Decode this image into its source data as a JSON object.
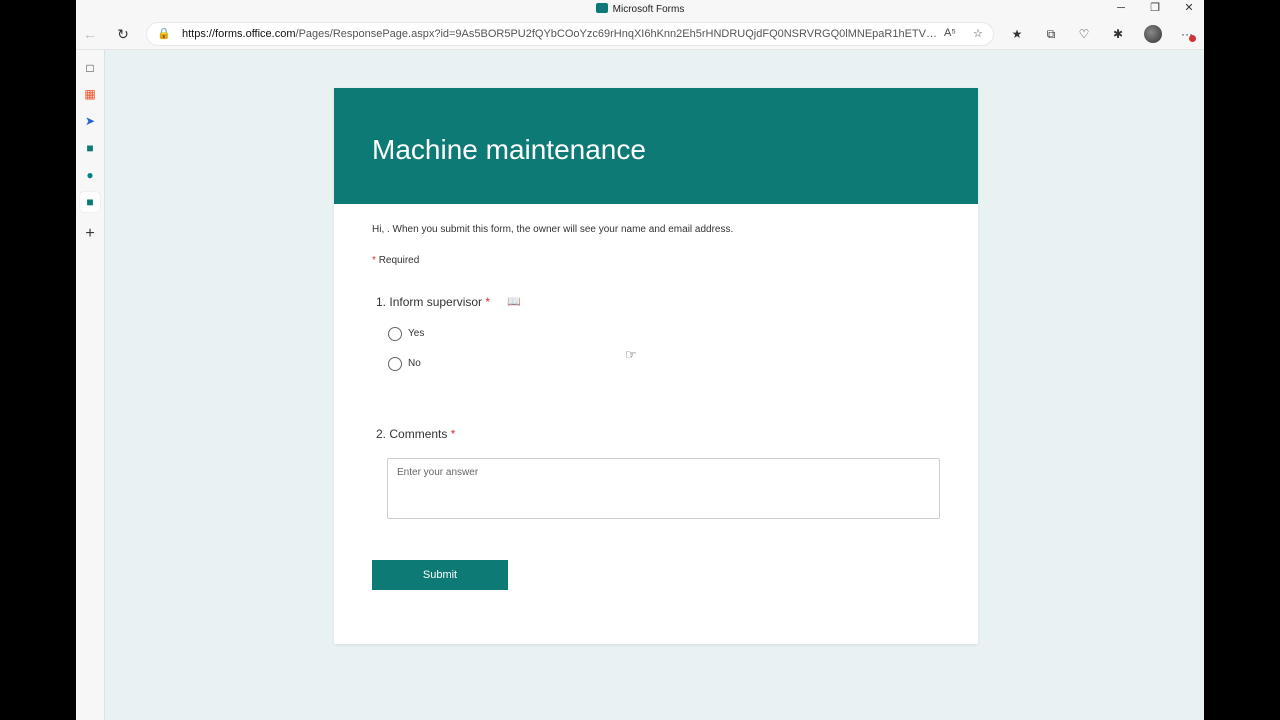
{
  "browser": {
    "window_title": "Microsoft Forms",
    "url_domain": "https://forms.office.com",
    "url_rest": "/Pages/ResponsePage.aspx?id=9As5BOR5PU2fQYbCOoYzc69rHnqXI6hKnn2Eh5rHNDRUQjdFQ0NSRVRGQ0lMNEpaR1hETVFMQkM1WS...",
    "controls": {
      "minimize": "─",
      "restore": "❐",
      "close": "✕"
    },
    "nav_icons": {
      "back": "back-arrow-icon",
      "refresh": "refresh-icon"
    },
    "toolbar_icons": [
      "read-aloud-icon",
      "add-favorite-icon",
      "favorites-icon",
      "collections-icon",
      "browser-essentials-icon",
      "extensions-icon",
      "profile-avatar",
      "settings-more-icon"
    ],
    "sidebar_icons": [
      "tab-actions-icon",
      "microsoft-365-icon",
      "bing-icon",
      "forms-icon",
      "sharepoint-icon",
      "forms-active-icon",
      "add-icon"
    ]
  },
  "form": {
    "title": "Machine maintenance",
    "intro": "Hi, . When you submit this form, the owner will see your name and email address.",
    "required_marker": "*",
    "required_label": "Required",
    "questions": [
      {
        "number": "1.",
        "title": "Inform supervisor",
        "required": "*",
        "type": "choice",
        "options": [
          "Yes",
          "No"
        ]
      },
      {
        "number": "2.",
        "title": "Comments",
        "required": "*",
        "type": "text",
        "placeholder": "Enter your answer"
      }
    ],
    "submit_label": "Submit"
  },
  "colors": {
    "accent": "#0e7a76",
    "background": "#e9f2f2",
    "required": "#d13438"
  }
}
